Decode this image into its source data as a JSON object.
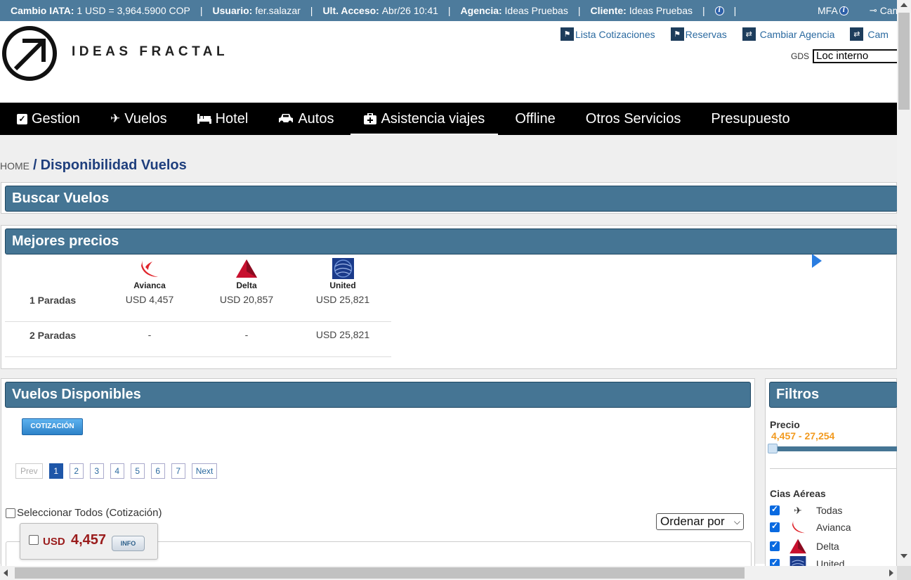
{
  "topbar": {
    "cambio_label": "Cambio IATA:",
    "cambio_value": "1 USD = 3,964.5900 COP",
    "usuario_label": "Usuario:",
    "usuario_value": "fer.salazar",
    "acceso_label": "Ult. Acceso:",
    "acceso_value": "Abr/26 10:41",
    "agencia_label": "Agencia:",
    "agencia_value": "Ideas Pruebas",
    "cliente_label": "Cliente:",
    "cliente_value": "Ideas Pruebas",
    "separator": "|",
    "info_glyph": "i",
    "mfa_label": "MFA",
    "cambiar_partial": "Cam"
  },
  "header": {
    "logo_text": "IDEAS FRACTAL",
    "links": [
      {
        "label": "Lista Cotizaciones",
        "icon": "flag-icon"
      },
      {
        "label": "Reservas",
        "icon": "flag-icon"
      },
      {
        "label": "Cambiar Agencia",
        "icon": "swap-icon"
      },
      {
        "label": "Cam",
        "icon": "swap-icon"
      }
    ],
    "gds_label": "GDS",
    "gds_value": "Loc interno"
  },
  "nav": {
    "items": [
      {
        "label": "Gestion",
        "icon": "check-icon"
      },
      {
        "label": "Vuelos",
        "icon": "plane-icon"
      },
      {
        "label": "Hotel",
        "icon": "bed-icon"
      },
      {
        "label": "Autos",
        "icon": "car-icon"
      },
      {
        "label": "Asistencia viajes",
        "icon": "medkit-icon"
      },
      {
        "label": "Offline",
        "icon": ""
      },
      {
        "label": "Otros Servicios",
        "icon": ""
      },
      {
        "label": "Presupuesto",
        "icon": ""
      }
    ]
  },
  "breadcrumb": {
    "home": "HOME",
    "separator": "/",
    "current": "Disponibilidad Vuelos"
  },
  "buscar": {
    "title": "Buscar Vuelos"
  },
  "mejores": {
    "title": "Mejores precios",
    "airlines": [
      "Avianca",
      "Delta",
      "United"
    ],
    "rows": [
      {
        "label": "1 Paradas",
        "values": [
          "USD 4,457",
          "USD 20,857",
          "USD 25,821"
        ]
      },
      {
        "label": "2 Paradas",
        "values": [
          "-",
          "-",
          "USD 25,821"
        ]
      }
    ]
  },
  "vuelos": {
    "title": "Vuelos Disponibles",
    "cotizacion_button": "COTIZACIÓN",
    "pager": {
      "prev": "Prev",
      "pages": [
        "1",
        "2",
        "3",
        "4",
        "5",
        "6",
        "7"
      ],
      "current": "1",
      "next": "Next"
    },
    "select_all": "Seleccionar Todos (Cotización)",
    "order_by": "Ordenar por",
    "result": {
      "currency": "USD",
      "amount": "4,457",
      "info_button": "INFO"
    }
  },
  "filtros": {
    "title": "Filtros",
    "precio_label": "Precio",
    "precio_range": "4,457 - 27,254",
    "cias_label": "Cias Aéreas",
    "airlines": [
      {
        "label": "Todas",
        "icon": "plane-icon",
        "checked": true
      },
      {
        "label": "Avianca",
        "icon": "avianca-logo-icon",
        "checked": true
      },
      {
        "label": "Delta",
        "icon": "delta-logo-icon",
        "checked": true
      },
      {
        "label": "United",
        "icon": "united-logo-icon",
        "checked": true
      }
    ]
  },
  "colors": {
    "topbar_bg": "#4d7b9c",
    "panel_head": "#457594",
    "accent_blue": "#1f3f7d",
    "price_red": "#9a1c1c",
    "range_orange": "#f29a1f"
  }
}
